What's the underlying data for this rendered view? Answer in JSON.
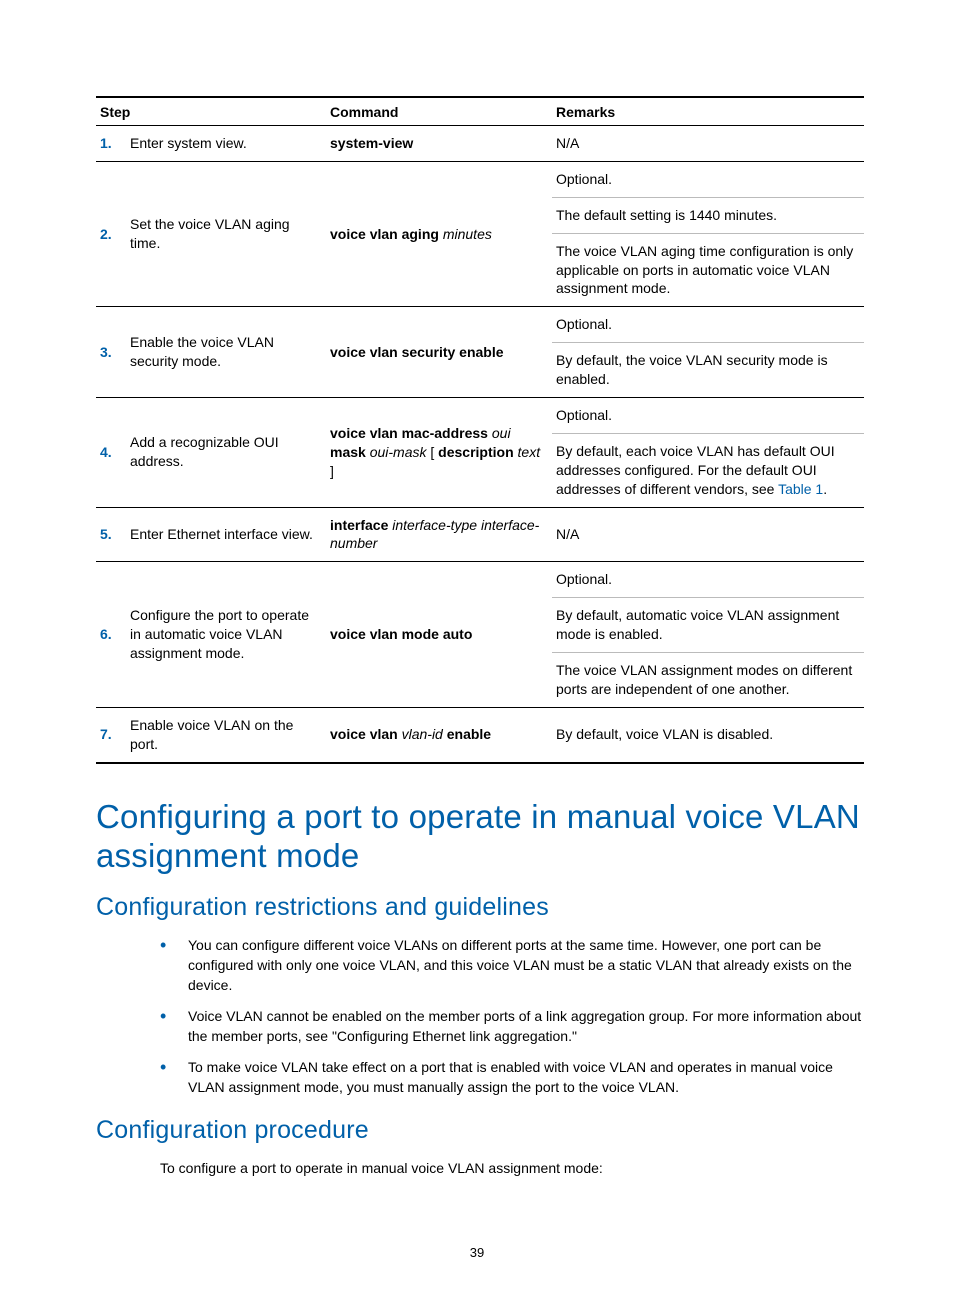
{
  "table": {
    "headers": {
      "step": "Step",
      "command": "Command",
      "remarks": "Remarks"
    },
    "rows": [
      {
        "num": "1.",
        "step": "Enter system view.",
        "command_html": "<span class='cmd-bold'>system-view</span>",
        "remarks": [
          "N/A"
        ]
      },
      {
        "num": "2.",
        "step": "Set the voice VLAN aging time.",
        "command_html": "<span class='cmd-bold'>voice vlan aging</span> <span class='cmd-ital'>minutes</span>",
        "remarks": [
          "Optional.",
          "The default setting is 1440 minutes.",
          "The voice VLAN aging time configuration is only applicable on ports in automatic voice VLAN assignment mode."
        ]
      },
      {
        "num": "3.",
        "step": "Enable the voice VLAN security mode.",
        "command_html": "<span class='cmd-bold'>voice vlan security enable</span>",
        "remarks": [
          "Optional.",
          "By default, the voice VLAN security mode is enabled."
        ]
      },
      {
        "num": "4.",
        "step": "Add a recognizable OUI address.",
        "command_html": "<span class='cmd-bold'>voice vlan mac-address</span> <span class='cmd-ital'>oui</span> <span class='cmd-bold'>mask</span> <span class='cmd-ital'>oui-mask</span> [ <span class='cmd-bold'>description</span> <span class='cmd-ital'>text</span> ]",
        "remarks": [
          "Optional.",
          "By default, each voice VLAN has default OUI addresses configured. For the default OUI addresses of different vendors, see <a class='inline-link' href='#'>Table 1</a>."
        ]
      },
      {
        "num": "5.",
        "step": "Enter Ethernet interface view.",
        "command_html": "<span class='cmd-bold'>interface</span> <span class='cmd-ital'>interface-type interface-number</span>",
        "remarks": [
          "N/A"
        ]
      },
      {
        "num": "6.",
        "step": "Configure the port to operate in automatic voice VLAN assignment mode.",
        "command_html": "<span class='cmd-bold'>voice vlan mode auto</span>",
        "remarks": [
          "Optional.",
          "By default, automatic voice VLAN assignment mode is enabled.",
          "The voice VLAN assignment modes on different ports are independent of one another."
        ]
      },
      {
        "num": "7.",
        "step": "Enable voice VLAN on the port.",
        "command_html": "<span class='cmd-bold'>voice vlan</span> <span class='cmd-ital'>vlan-id</span> <span class='cmd-bold'>enable</span>",
        "remarks": [
          "By default, voice VLAN is disabled."
        ]
      }
    ]
  },
  "headings": {
    "h1": "Configuring a port to operate in manual voice VLAN assignment mode",
    "h2a": "Configuration restrictions and guidelines",
    "h2b": "Configuration procedure"
  },
  "bullets": [
    "You can configure different voice VLANs on different ports at the same time. However, one port can be configured with only one voice VLAN, and this voice VLAN must be a static VLAN that already exists on the device.",
    "Voice VLAN cannot be enabled on the member ports of a link aggregation group. For more information about the member ports, see \"Configuring Ethernet link aggregation.\"",
    "To make voice VLAN take effect on a port that is enabled with voice VLAN and operates in manual voice VLAN assignment mode, you must manually assign the port to the voice VLAN."
  ],
  "procedure_intro": "To configure a port to operate in manual voice VLAN assignment mode:",
  "page_number": "39"
}
